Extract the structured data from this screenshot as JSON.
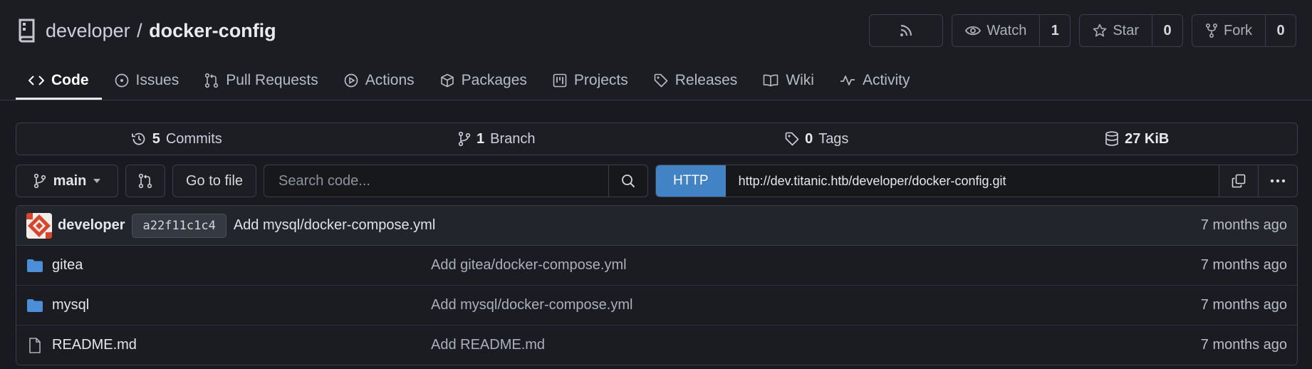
{
  "repo": {
    "owner": "developer",
    "separator": "/",
    "name": "docker-config"
  },
  "actions": {
    "watch_label": "Watch",
    "watch_count": "1",
    "star_label": "Star",
    "star_count": "0",
    "fork_label": "Fork",
    "fork_count": "0"
  },
  "tabs": [
    {
      "label": "Code",
      "icon": "code-icon"
    },
    {
      "label": "Issues",
      "icon": "issue-icon"
    },
    {
      "label": "Pull Requests",
      "icon": "pull-request-icon"
    },
    {
      "label": "Actions",
      "icon": "play-icon"
    },
    {
      "label": "Packages",
      "icon": "package-icon"
    },
    {
      "label": "Projects",
      "icon": "project-icon"
    },
    {
      "label": "Releases",
      "icon": "tag-icon"
    },
    {
      "label": "Wiki",
      "icon": "book-icon"
    },
    {
      "label": "Activity",
      "icon": "pulse-icon"
    }
  ],
  "stats": {
    "commits_count": "5",
    "commits_label": "Commits",
    "branch_count": "1",
    "branch_label": "Branch",
    "tags_count": "0",
    "tags_label": "Tags",
    "size": "27 KiB"
  },
  "toolbar": {
    "branch": "main",
    "goto_file": "Go to file",
    "search_placeholder": "Search code...",
    "clone_protocol": "HTTP",
    "clone_url": "http://dev.titanic.htb/developer/docker-config.git"
  },
  "latest_commit": {
    "author": "developer",
    "sha": "a22f11c1c4",
    "message": "Add mysql/docker-compose.yml",
    "time": "7 months ago"
  },
  "files": [
    {
      "name": "gitea",
      "type": "folder",
      "message": "Add gitea/docker-compose.yml",
      "time": "7 months ago"
    },
    {
      "name": "mysql",
      "type": "folder",
      "message": "Add mysql/docker-compose.yml",
      "time": "7 months ago"
    },
    {
      "name": "README.md",
      "type": "file",
      "message": "Add README.md",
      "time": "7 months ago"
    }
  ],
  "colors": {
    "accent": "#4183c4",
    "folder": "#4a8fd8",
    "background": "#181a1f"
  }
}
